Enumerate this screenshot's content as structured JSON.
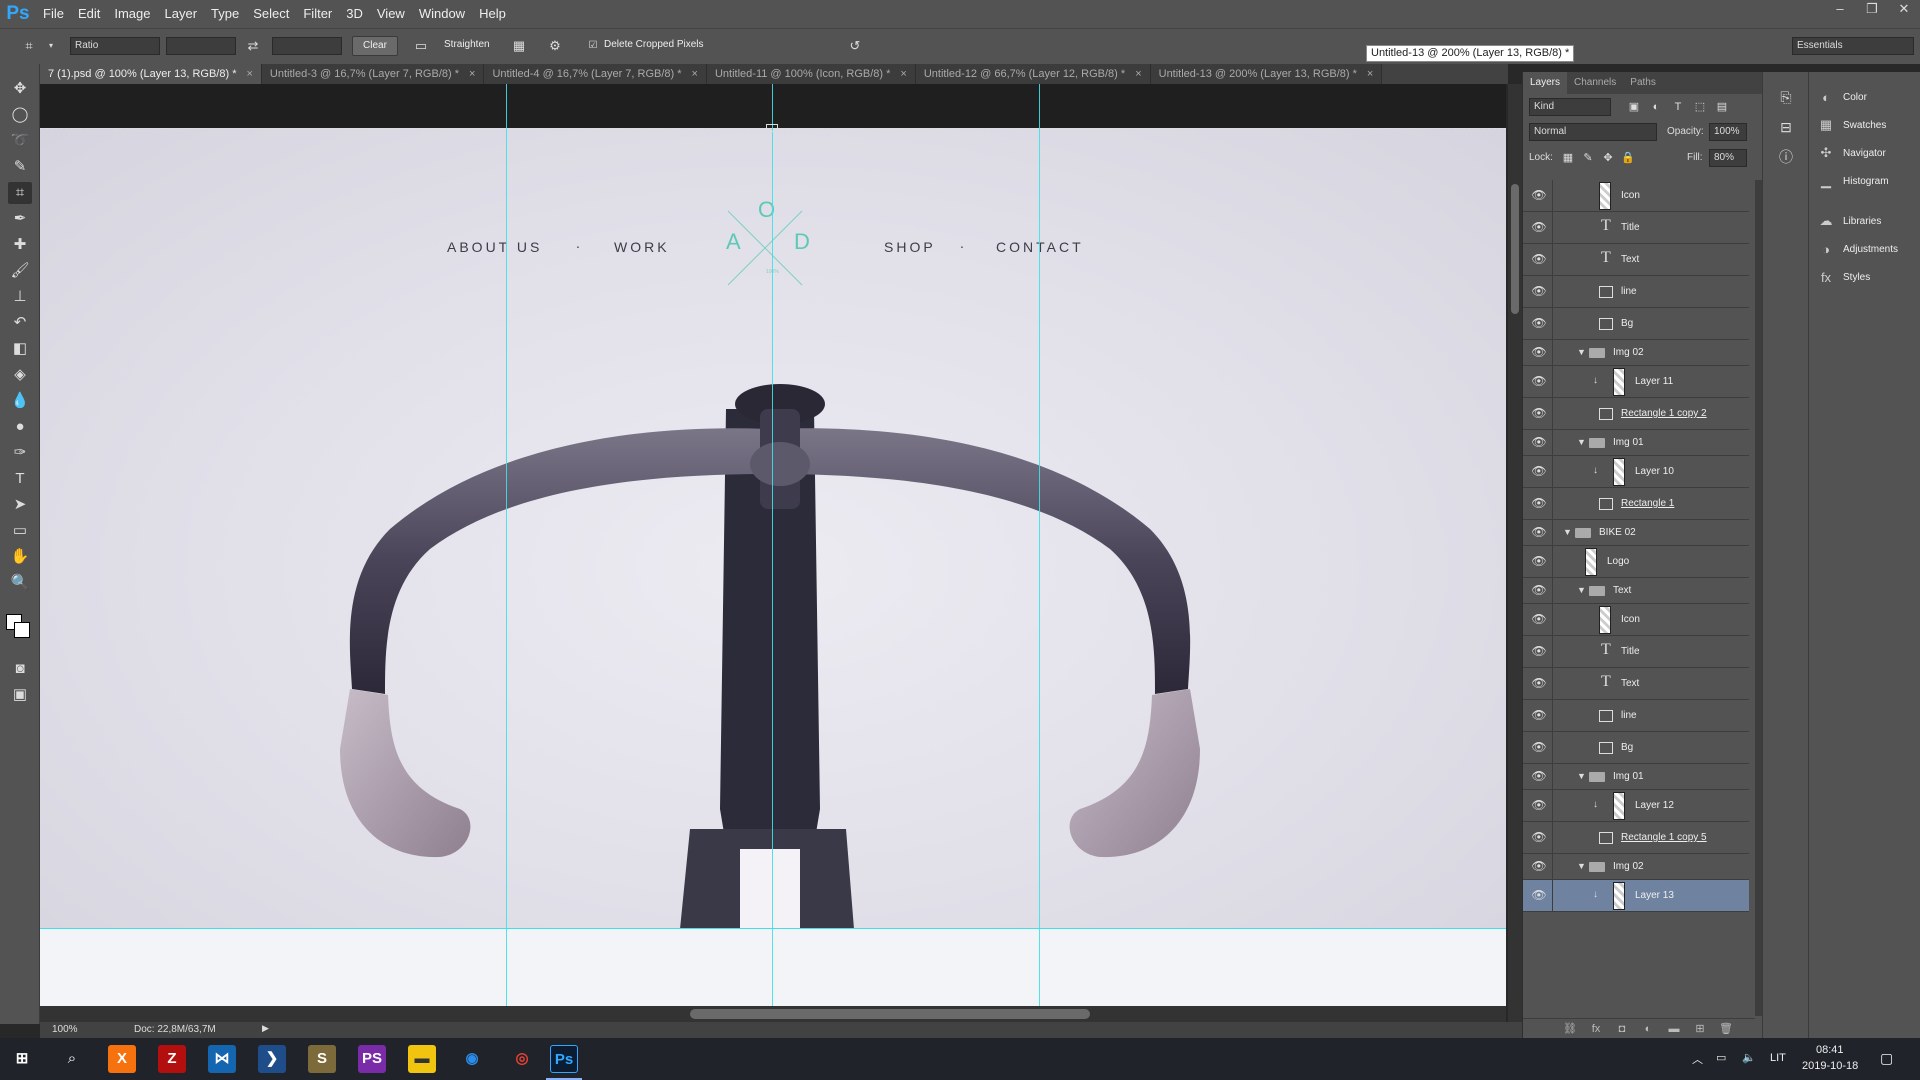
{
  "app": {
    "logo": "Ps"
  },
  "menu": [
    "File",
    "Edit",
    "Image",
    "Layer",
    "Type",
    "Select",
    "Filter",
    "3D",
    "View",
    "Window",
    "Help"
  ],
  "window_controls": {
    "minimize": "–",
    "restore": "❐",
    "close": "✕"
  },
  "options_bar": {
    "ratio": "Ratio",
    "clear": "Clear",
    "straighten": "Straighten",
    "delete_cropped": "Delete Cropped Pixels",
    "workspace": "Essentials",
    "tooltip": "Untitled-13 @ 200% (Layer 13, RGB/8) *"
  },
  "tabs": [
    {
      "label": "7 (1).psd @ 100% (Layer 13, RGB/8) *",
      "active": true
    },
    {
      "label": "Untitled-3 @ 16,7% (Layer 7, RGB/8) *",
      "active": false
    },
    {
      "label": "Untitled-4 @ 16,7% (Layer 7, RGB/8) *",
      "active": false
    },
    {
      "label": "Untitled-11 @ 100% (Icon, RGB/8) *",
      "active": false
    },
    {
      "label": "Untitled-12 @ 66,7% (Layer 12, RGB/8) *",
      "active": false
    },
    {
      "label": "Untitled-13 @ 200% (Layer 13, RGB/8) *",
      "active": false
    }
  ],
  "tab_close": "×",
  "canvas": {
    "nav": {
      "about": "ABOUT US",
      "work": "WORK",
      "shop": "SHOP",
      "contact": "CONTACT",
      "dot": "."
    },
    "logo": {
      "top": "O",
      "left": "A",
      "right": "D",
      "small": "100%"
    }
  },
  "status": {
    "zoom": "100%",
    "doc": "Doc: 22,8M/63,7M"
  },
  "layers_panel": {
    "tabs": [
      "Layers",
      "Channels",
      "Paths"
    ],
    "kind": "Kind",
    "blend_mode": "Normal",
    "opacity_label": "Opacity:",
    "opacity_value": "100%",
    "lock_label": "Lock:",
    "fill_label": "Fill:",
    "fill_value": "80%",
    "layers": [
      {
        "name": "Icon",
        "kind": "pixel",
        "indent": 2
      },
      {
        "name": "Title",
        "kind": "type",
        "indent": 2
      },
      {
        "name": "Text",
        "kind": "type",
        "indent": 2
      },
      {
        "name": "line",
        "kind": "shape",
        "indent": 2
      },
      {
        "name": "Bg",
        "kind": "shape",
        "indent": 2
      },
      {
        "name": "Img 02",
        "kind": "group",
        "indent": 1
      },
      {
        "name": "Layer 11",
        "kind": "pixel-clip",
        "indent": 3
      },
      {
        "name": "Rectangle 1 copy 2",
        "kind": "shape",
        "indent": 2,
        "underline": true
      },
      {
        "name": "Img 01",
        "kind": "group",
        "indent": 1
      },
      {
        "name": "Layer 10",
        "kind": "pixel-clip",
        "indent": 3
      },
      {
        "name": "Rectangle 1",
        "kind": "shape",
        "indent": 2,
        "underline": true
      },
      {
        "name": "BIKE 02",
        "kind": "group",
        "indent": 0
      },
      {
        "name": "Logo",
        "kind": "pixel",
        "indent": 1
      },
      {
        "name": "Text",
        "kind": "group",
        "indent": 1
      },
      {
        "name": "Icon",
        "kind": "pixel",
        "indent": 2
      },
      {
        "name": "Title",
        "kind": "type",
        "indent": 2
      },
      {
        "name": "Text",
        "kind": "type",
        "indent": 2
      },
      {
        "name": "line",
        "kind": "shape",
        "indent": 2
      },
      {
        "name": "Bg",
        "kind": "shape",
        "indent": 2
      },
      {
        "name": "Img 01",
        "kind": "group",
        "indent": 1
      },
      {
        "name": "Layer 12",
        "kind": "pixel-clip",
        "indent": 3
      },
      {
        "name": "Rectangle 1 copy 5",
        "kind": "shape",
        "indent": 2,
        "underline": true
      },
      {
        "name": "Img 02",
        "kind": "group",
        "indent": 1
      },
      {
        "name": "Layer 13",
        "kind": "pixel-clip",
        "indent": 3,
        "selected": true
      }
    ]
  },
  "right_dock": [
    "Color",
    "Swatches",
    "Navigator",
    "Histogram",
    "Libraries",
    "Adjustments",
    "Styles"
  ],
  "taskbar": {
    "lang": "LIT",
    "time": "08:41",
    "date": "2019-10-18"
  }
}
